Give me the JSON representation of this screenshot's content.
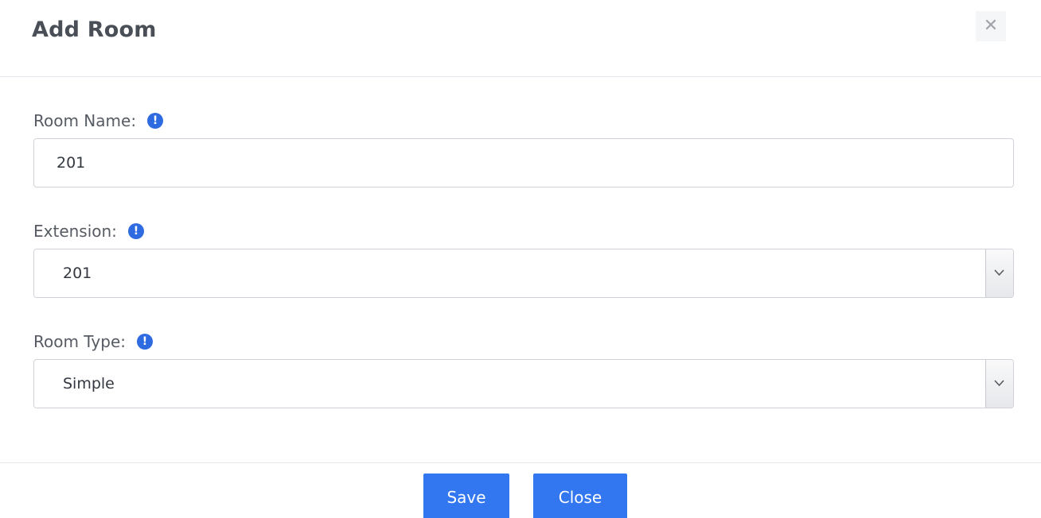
{
  "dialog": {
    "title": "Add Room",
    "close_icon": "close-icon",
    "close_glyph": "✕"
  },
  "form": {
    "room_name": {
      "label": "Room Name:",
      "info_icon": "info-icon",
      "value": "201"
    },
    "extension": {
      "label": "Extension:",
      "info_icon": "info-icon",
      "value": "201"
    },
    "room_type": {
      "label": "Room Type:",
      "info_icon": "info-icon",
      "value": "Simple"
    },
    "info_glyph": "!"
  },
  "footer": {
    "save_label": "Save",
    "close_label": "Close"
  },
  "colors": {
    "accent": "#3277f0",
    "info": "#2f6be0",
    "title_text": "#4a4f57",
    "border": "#cfd3d9"
  }
}
